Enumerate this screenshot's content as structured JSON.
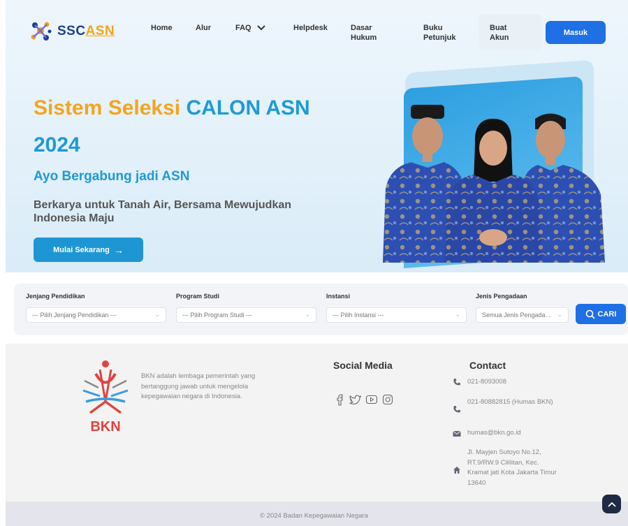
{
  "nav": {
    "logo_text_a": "SSC",
    "logo_text_b": "ASN",
    "items": [
      {
        "label": "Home"
      },
      {
        "label": "Alur"
      },
      {
        "label": "FAQ"
      },
      {
        "label": "Helpdesk"
      },
      {
        "label": "Dasar Hukum"
      },
      {
        "label": "Buku Petunjuk"
      },
      {
        "label": "Buat Akun"
      }
    ],
    "login_label": "Masuk"
  },
  "hero": {
    "title_part1": "Sistem Seleksi",
    "title_part2": "CALON ASN",
    "year": "2024",
    "subtitle": "Ayo Bergabung jadi ASN",
    "description": "Berkarya untuk Tanah Air, Bersama Mewujudkan Indonesia Maju",
    "cta_label": "Mulai Sekarang",
    "cta_arrow": "→"
  },
  "search": {
    "fields": [
      {
        "label": "Jenjang Pendidikan",
        "value": "--- Pilih Jenjang Pendidikan ---"
      },
      {
        "label": "Program Studi",
        "value": "--- Pilih Program Studi ---"
      },
      {
        "label": "Instansi",
        "value": "--- Pilih Instansi ---"
      },
      {
        "label": "Jenis Pengadaan",
        "value": "Semua Jenis Pengada..."
      }
    ],
    "search_label": "CARI"
  },
  "footer": {
    "bkn_logo_text": "BKN",
    "about": "BKN adalah lembaga pemerintah yang bertanggung jawab untuk mengelola kepegawaian negara di Indonesia.",
    "social_title": "Social Media",
    "contact_title": "Contact",
    "phone1": "021-8093008",
    "phone2": "021-80882815 (Humas BKN)",
    "email": "humas@bkn.go.id",
    "address": "Jl. Mayjen Sutoyo No.12, RT.9/RW.9 Cililitan, Kec. Kramat jati Kota Jakarta Timur 13640",
    "copyright": "© 2024  Badan Kepegawaian Negara"
  },
  "colors": {
    "primary_blue": "#1f6fe5",
    "hero_blue": "#1f9ad6",
    "hero_yellow": "#f4a51c"
  }
}
